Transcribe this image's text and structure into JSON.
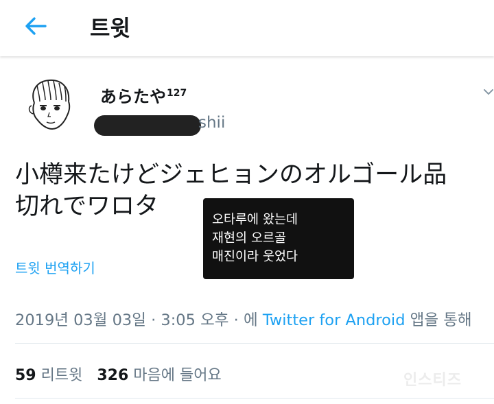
{
  "header": {
    "title": "트윗"
  },
  "author": {
    "display_name": "あらたや",
    "name_suffix": "127",
    "handle_visible": "shii"
  },
  "tweet": {
    "text_line1": "小樽来たけどジェヒョンのオルゴール品",
    "text_line2": "切れでワロタ",
    "translate_label": "트윗 번역하기"
  },
  "overlay_caption": {
    "line1": "오타루에 왔는데",
    "line2": "재현의 오르골",
    "line3": "매진이라 웃었다"
  },
  "meta": {
    "date": "2019년 03월 03일",
    "time": "3:05 오후",
    "via_prefix": "에",
    "source": "Twitter for Android",
    "via_suffix": "앱을 통해"
  },
  "stats": {
    "retweet_count": "59",
    "retweet_label": "리트윗",
    "like_count": "326",
    "like_label": "마음에 들어요"
  },
  "watermark": "인스티즈",
  "colors": {
    "accent": "#1da1f2",
    "secondary_text": "#657786",
    "primary_text": "#14171a"
  },
  "icons": [
    "back-arrow-icon",
    "chevron-down-icon"
  ]
}
